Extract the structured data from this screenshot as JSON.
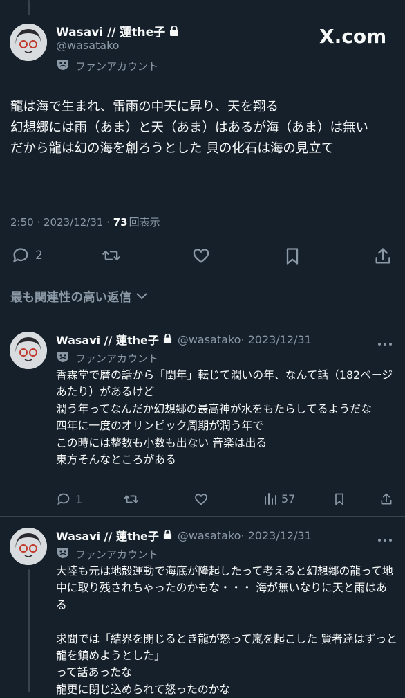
{
  "brand": "X.com",
  "main_tweet": {
    "author_name": "Wasavi // 蓮the子",
    "handle": "@wasatako",
    "label": "ファンアカウント",
    "text": "龍は海で生まれ、雷雨の中天に昇り、天を翔る\n幻想郷には雨（あま）と天（あま）はあるが海（あま）は無い\nだから龍は幻の海を創ろうとした 貝の化石は海の見立て",
    "time": "2:50 · 2023/12/31 · ",
    "views": "73",
    "views_label": "回表示",
    "replies": "2"
  },
  "sort_label": "最も関連性の高い返信",
  "replies": [
    {
      "author_name": "Wasavi // 蓮the子",
      "handle": "@wasatako",
      "date": "· 2023/12/31",
      "label": "ファンアカウント",
      "text": "香霖堂で暦の話から「閏年」転じて潤いの年、なんて話（182ページあたり）があるけど\n潤う年ってなんだか幻想郷の最高神が水をもたらしてるようだな\n四年に一度のオリンピック周期が潤う年で\nこの時には整数も小数も出ない 音楽は出る\n東方そんなところがある",
      "replies": "1",
      "views": "57"
    },
    {
      "author_name": "Wasavi // 蓮the子",
      "handle": "@wasatako",
      "date": "· 2023/12/31",
      "label": "ファンアカウント",
      "text": "大陸も元は地殻運動で海底が隆起したって考えると幻想郷の龍って地中に取り残されちゃったのかもな・・・ 海が無いなりに天と雨はある\n\n求聞では「結界を閉じるとき龍が怒って嵐を起こした 賢者達はずっと龍を鎮めようとした」\nって話あったな\n龍更に閉じ込められて怒ったのかな"
    }
  ]
}
